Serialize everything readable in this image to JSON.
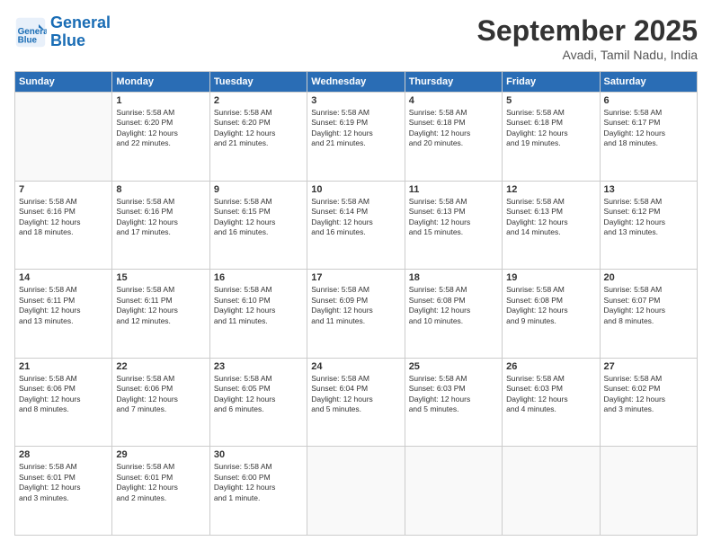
{
  "logo": {
    "line1": "General",
    "line2": "Blue"
  },
  "title": "September 2025",
  "subtitle": "Avadi, Tamil Nadu, India",
  "days_of_week": [
    "Sunday",
    "Monday",
    "Tuesday",
    "Wednesday",
    "Thursday",
    "Friday",
    "Saturday"
  ],
  "weeks": [
    [
      {
        "day": "",
        "info": ""
      },
      {
        "day": "1",
        "info": "Sunrise: 5:58 AM\nSunset: 6:20 PM\nDaylight: 12 hours\nand 22 minutes."
      },
      {
        "day": "2",
        "info": "Sunrise: 5:58 AM\nSunset: 6:20 PM\nDaylight: 12 hours\nand 21 minutes."
      },
      {
        "day": "3",
        "info": "Sunrise: 5:58 AM\nSunset: 6:19 PM\nDaylight: 12 hours\nand 21 minutes."
      },
      {
        "day": "4",
        "info": "Sunrise: 5:58 AM\nSunset: 6:18 PM\nDaylight: 12 hours\nand 20 minutes."
      },
      {
        "day": "5",
        "info": "Sunrise: 5:58 AM\nSunset: 6:18 PM\nDaylight: 12 hours\nand 19 minutes."
      },
      {
        "day": "6",
        "info": "Sunrise: 5:58 AM\nSunset: 6:17 PM\nDaylight: 12 hours\nand 18 minutes."
      }
    ],
    [
      {
        "day": "7",
        "info": "Sunrise: 5:58 AM\nSunset: 6:16 PM\nDaylight: 12 hours\nand 18 minutes."
      },
      {
        "day": "8",
        "info": "Sunrise: 5:58 AM\nSunset: 6:16 PM\nDaylight: 12 hours\nand 17 minutes."
      },
      {
        "day": "9",
        "info": "Sunrise: 5:58 AM\nSunset: 6:15 PM\nDaylight: 12 hours\nand 16 minutes."
      },
      {
        "day": "10",
        "info": "Sunrise: 5:58 AM\nSunset: 6:14 PM\nDaylight: 12 hours\nand 16 minutes."
      },
      {
        "day": "11",
        "info": "Sunrise: 5:58 AM\nSunset: 6:13 PM\nDaylight: 12 hours\nand 15 minutes."
      },
      {
        "day": "12",
        "info": "Sunrise: 5:58 AM\nSunset: 6:13 PM\nDaylight: 12 hours\nand 14 minutes."
      },
      {
        "day": "13",
        "info": "Sunrise: 5:58 AM\nSunset: 6:12 PM\nDaylight: 12 hours\nand 13 minutes."
      }
    ],
    [
      {
        "day": "14",
        "info": "Sunrise: 5:58 AM\nSunset: 6:11 PM\nDaylight: 12 hours\nand 13 minutes."
      },
      {
        "day": "15",
        "info": "Sunrise: 5:58 AM\nSunset: 6:11 PM\nDaylight: 12 hours\nand 12 minutes."
      },
      {
        "day": "16",
        "info": "Sunrise: 5:58 AM\nSunset: 6:10 PM\nDaylight: 12 hours\nand 11 minutes."
      },
      {
        "day": "17",
        "info": "Sunrise: 5:58 AM\nSunset: 6:09 PM\nDaylight: 12 hours\nand 11 minutes."
      },
      {
        "day": "18",
        "info": "Sunrise: 5:58 AM\nSunset: 6:08 PM\nDaylight: 12 hours\nand 10 minutes."
      },
      {
        "day": "19",
        "info": "Sunrise: 5:58 AM\nSunset: 6:08 PM\nDaylight: 12 hours\nand 9 minutes."
      },
      {
        "day": "20",
        "info": "Sunrise: 5:58 AM\nSunset: 6:07 PM\nDaylight: 12 hours\nand 8 minutes."
      }
    ],
    [
      {
        "day": "21",
        "info": "Sunrise: 5:58 AM\nSunset: 6:06 PM\nDaylight: 12 hours\nand 8 minutes."
      },
      {
        "day": "22",
        "info": "Sunrise: 5:58 AM\nSunset: 6:06 PM\nDaylight: 12 hours\nand 7 minutes."
      },
      {
        "day": "23",
        "info": "Sunrise: 5:58 AM\nSunset: 6:05 PM\nDaylight: 12 hours\nand 6 minutes."
      },
      {
        "day": "24",
        "info": "Sunrise: 5:58 AM\nSunset: 6:04 PM\nDaylight: 12 hours\nand 5 minutes."
      },
      {
        "day": "25",
        "info": "Sunrise: 5:58 AM\nSunset: 6:03 PM\nDaylight: 12 hours\nand 5 minutes."
      },
      {
        "day": "26",
        "info": "Sunrise: 5:58 AM\nSunset: 6:03 PM\nDaylight: 12 hours\nand 4 minutes."
      },
      {
        "day": "27",
        "info": "Sunrise: 5:58 AM\nSunset: 6:02 PM\nDaylight: 12 hours\nand 3 minutes."
      }
    ],
    [
      {
        "day": "28",
        "info": "Sunrise: 5:58 AM\nSunset: 6:01 PM\nDaylight: 12 hours\nand 3 minutes."
      },
      {
        "day": "29",
        "info": "Sunrise: 5:58 AM\nSunset: 6:01 PM\nDaylight: 12 hours\nand 2 minutes."
      },
      {
        "day": "30",
        "info": "Sunrise: 5:58 AM\nSunset: 6:00 PM\nDaylight: 12 hours\nand 1 minute."
      },
      {
        "day": "",
        "info": ""
      },
      {
        "day": "",
        "info": ""
      },
      {
        "day": "",
        "info": ""
      },
      {
        "day": "",
        "info": ""
      }
    ]
  ]
}
